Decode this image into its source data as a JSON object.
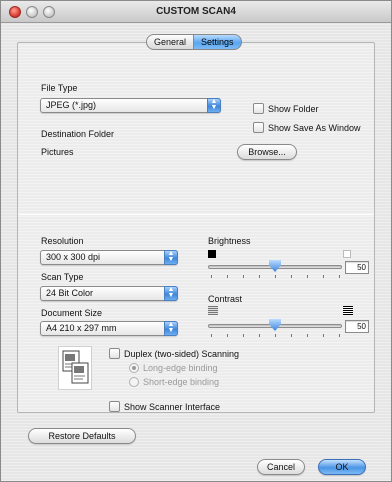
{
  "window": {
    "title": "CUSTOM SCAN4"
  },
  "tabs": [
    {
      "label": "General"
    },
    {
      "label": "Settings"
    }
  ],
  "file_type": {
    "label": "File Type",
    "value": "JPEG (*.jpg)",
    "show_folder": "Show Folder",
    "show_save_as": "Show Save As Window"
  },
  "destination": {
    "label": "Destination Folder",
    "value": "Pictures",
    "browse": "Browse..."
  },
  "resolution": {
    "label": "Resolution",
    "value": "300 x 300 dpi"
  },
  "scan_type": {
    "label": "Scan Type",
    "value": "24 Bit Color"
  },
  "document_size": {
    "label": "Document Size",
    "value": "A4  210 x 297 mm"
  },
  "brightness": {
    "label": "Brightness",
    "value": "50",
    "level": 0.5
  },
  "contrast": {
    "label": "Contrast",
    "value": "50",
    "level": 0.5
  },
  "duplex": {
    "label": "Duplex (two-sided) Scanning",
    "long_edge": "Long-edge binding",
    "short_edge": "Short-edge binding"
  },
  "scanner_interface": "Show Scanner Interface",
  "buttons": {
    "restore": "Restore Defaults",
    "cancel": "Cancel",
    "ok": "OK"
  },
  "colors": {
    "accent": "#4b95e6",
    "window_bg": "#e6e6e6"
  }
}
